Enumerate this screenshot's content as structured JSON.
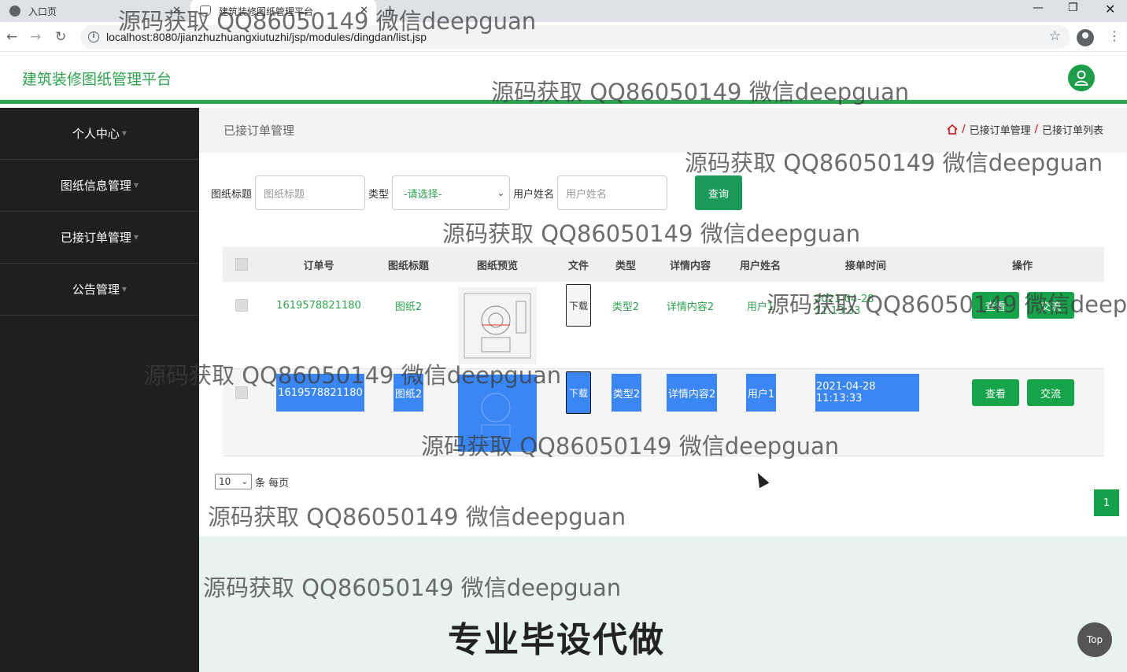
{
  "browser": {
    "tabs": [
      {
        "title": "入口页",
        "active": false
      },
      {
        "title": "建筑装修图纸管理平台",
        "active": true
      }
    ],
    "url": "localhost:8080/jianzhuzhuangxiutuzhi/jsp/modules/dingdan/list.jsp"
  },
  "app": {
    "brand": "建筑装修图纸管理平台",
    "accent": "#2ea34f",
    "sidebar": [
      {
        "label": "个人中心"
      },
      {
        "label": "图纸信息管理"
      },
      {
        "label": "已接订单管理"
      },
      {
        "label": "公告管理"
      }
    ]
  },
  "page": {
    "title": "已接订单管理",
    "breadcrumb": [
      "已接订单管理",
      "已接订单列表"
    ]
  },
  "search": {
    "title_label": "图纸标题",
    "title_placeholder": "图纸标题",
    "type_label": "类型",
    "type_value": "-请选择-",
    "username_label": "用户姓名",
    "username_placeholder": "用户姓名",
    "query_label": "查询"
  },
  "table": {
    "columns": [
      "订单号",
      "图纸标题",
      "图纸预览",
      "文件",
      "类型",
      "详情内容",
      "用户姓名",
      "接单时间",
      "操作"
    ],
    "rows": [
      {
        "order_no": "1619578821180",
        "title": "图纸2",
        "file": "下载",
        "type": "类型2",
        "detail": "详情内容2",
        "user": "用户1",
        "time": "2021-04-28 11:13:33",
        "view": "查看",
        "chat": "交流"
      },
      {
        "order_no": "1619578821180",
        "title": "图纸2",
        "file": "下载",
        "type": "类型2",
        "detail": "详情内容2",
        "user": "用户1",
        "time": "2021-04-28 11:13:33",
        "view": "查看",
        "chat": "交流"
      }
    ]
  },
  "pager": {
    "page_size": "10",
    "per_page_label": "条 每页",
    "current_page": "1"
  },
  "footer": {
    "promo": "专业毕设代做",
    "top_label": "Top"
  },
  "watermark": "源码获取 QQ86050149 微信deepguan"
}
